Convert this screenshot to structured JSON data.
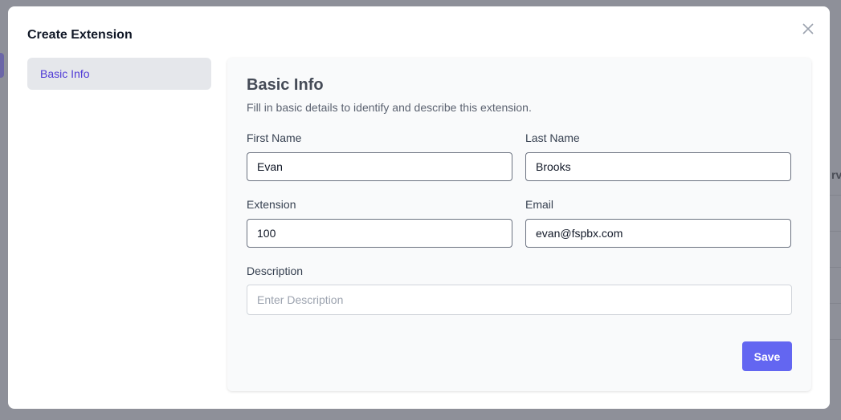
{
  "backdrop": {
    "partial_text": "rvi"
  },
  "modal": {
    "title": "Create Extension"
  },
  "nav": {
    "items": [
      {
        "label": "Basic Info"
      }
    ]
  },
  "panel": {
    "heading": "Basic Info",
    "description": "Fill in basic details to identify and describe this extension.",
    "fields": {
      "first_name": {
        "label": "First Name",
        "value": "Evan"
      },
      "last_name": {
        "label": "Last Name",
        "value": "Brooks"
      },
      "extension": {
        "label": "Extension",
        "value": "100"
      },
      "email": {
        "label": "Email",
        "value": "evan@fspbx.com"
      },
      "description": {
        "label": "Description",
        "value": "",
        "placeholder": "Enter Description"
      }
    },
    "save_label": "Save"
  }
}
